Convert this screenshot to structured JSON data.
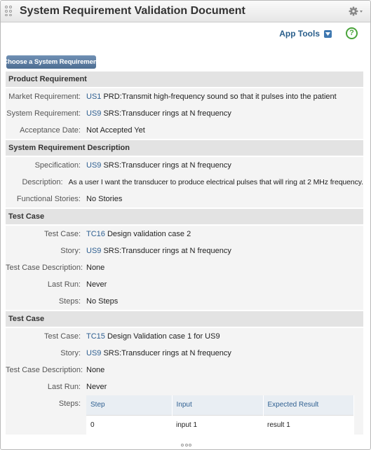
{
  "window": {
    "title": "System Requirement Validation Document"
  },
  "toolbar": {
    "app_tools_label": "App Tools",
    "help_label": "?"
  },
  "choose_button": {
    "label": "Choose a System Requirement"
  },
  "sections": {
    "product": {
      "header": "Product Requirement",
      "market_label": "Market Requirement:",
      "market_id": "US1",
      "market_text": "PRD:Transmit high-frequency sound so that it pulses into the patient",
      "system_label": "System Requirement:",
      "system_id": "US9",
      "system_text": "SRS:Transducer rings at N frequency",
      "acceptance_label": "Acceptance Date:",
      "acceptance_value": "Not Accepted Yet"
    },
    "description": {
      "header": "System Requirement Description",
      "spec_label": "Specification:",
      "spec_id": "US9",
      "spec_text": "SRS:Transducer rings at N frequency",
      "desc_label": "Description:",
      "desc_value": "As a user I want the transducer to produce electrical pulses that will ring at 2 MHz frequency.",
      "stories_label": "Functional Stories:",
      "stories_value": "No Stories"
    },
    "test_case_1": {
      "header": "Test Case",
      "tc_label": "Test Case:",
      "tc_id": "TC16",
      "tc_text": "Design validation case 2",
      "story_label": "Story:",
      "story_id": "US9",
      "story_text": "SRS:Transducer rings at N frequency",
      "tcdesc_label": "Test Case Description:",
      "tcdesc_value": "None",
      "lastrun_label": "Last Run:",
      "lastrun_value": "Never",
      "steps_label": "Steps:",
      "steps_value": "No Steps"
    },
    "test_case_2": {
      "header": "Test Case",
      "tc_label": "Test Case:",
      "tc_id": "TC15",
      "tc_text": "Design Validation case 1 for US9",
      "story_label": "Story:",
      "story_id": "US9",
      "story_text": "SRS:Transducer rings at N frequency",
      "tcdesc_label": "Test Case Description:",
      "tcdesc_value": "None",
      "lastrun_label": "Last Run:",
      "lastrun_value": "Never",
      "steps_label": "Steps:",
      "steps_table": {
        "headers": [
          "Step",
          "Input",
          "Expected Result"
        ],
        "rows": [
          [
            "0",
            "input 1",
            "result 1"
          ]
        ]
      }
    }
  },
  "colors": {
    "link": "#2e5f91",
    "button": "#5b7ba0",
    "help": "#4aa43b",
    "section_bg": "#e3e3e3",
    "row_bg": "#f4f4f4"
  }
}
